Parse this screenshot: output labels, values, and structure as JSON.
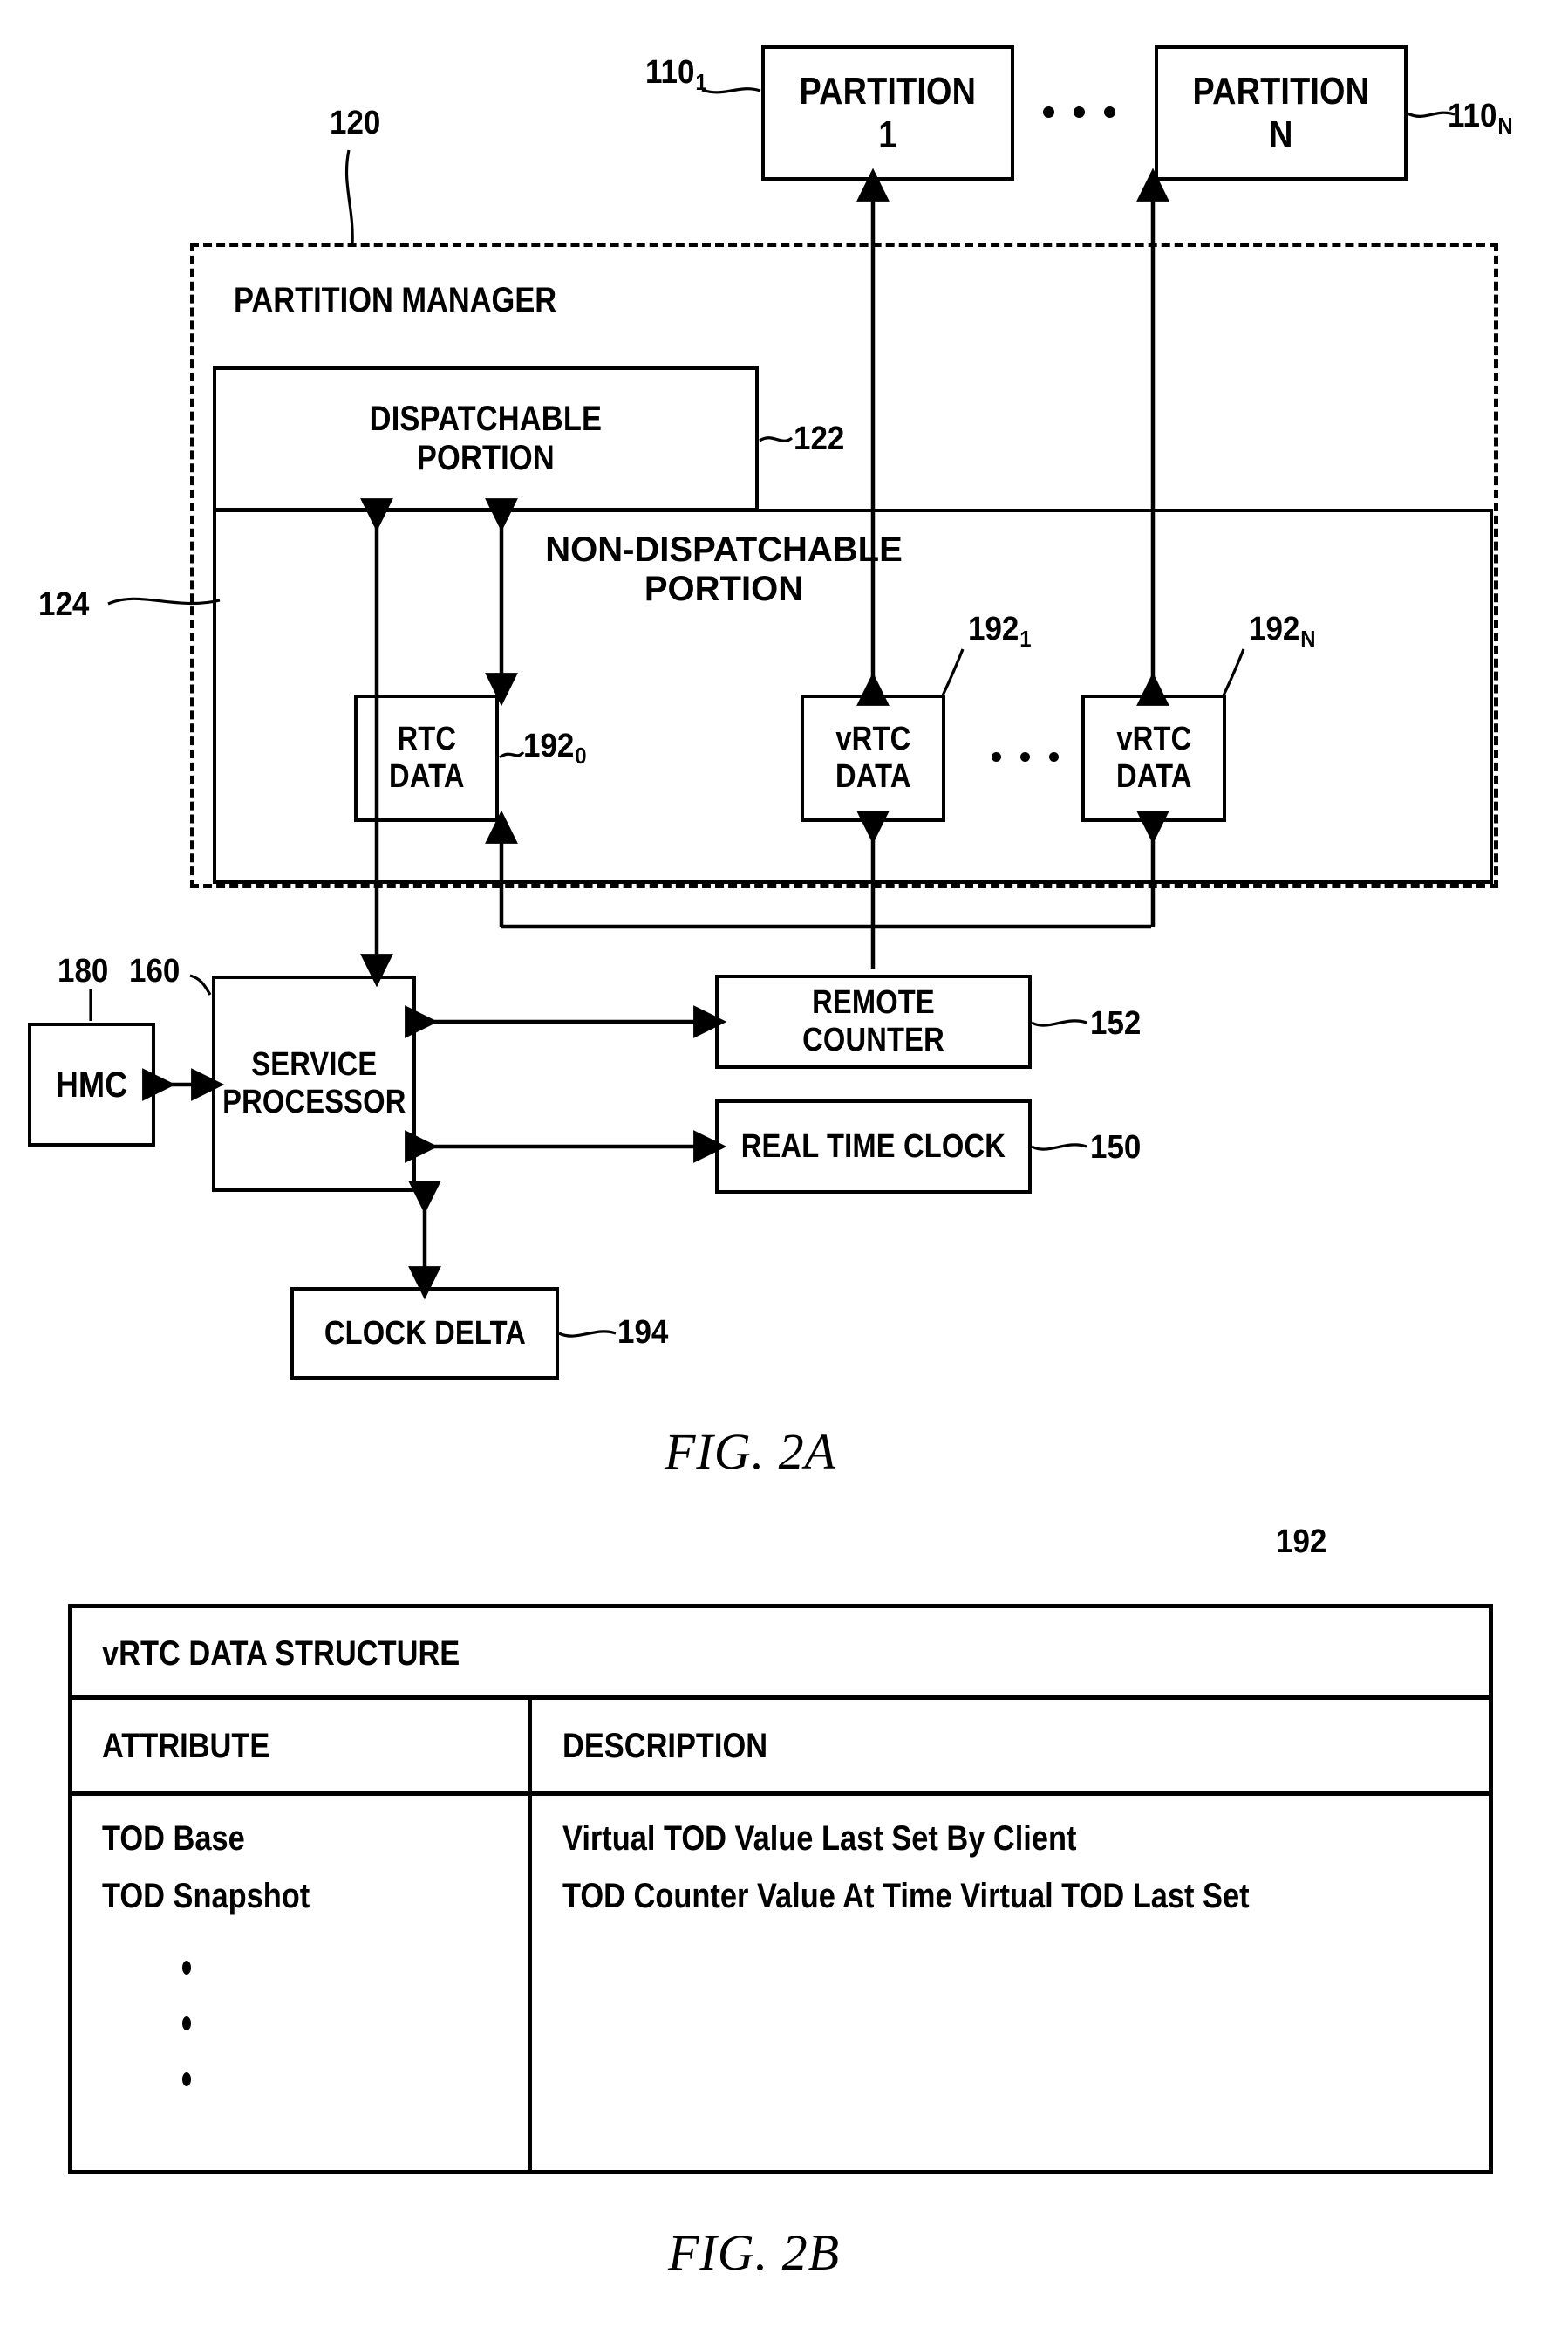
{
  "figures": {
    "fig2a_caption": "FIG. 2A",
    "fig2b_caption": "FIG. 2B"
  },
  "fig2a": {
    "partitions": [
      {
        "label": "PARTITION\n1",
        "ref": "110",
        "sub": "1"
      },
      {
        "label": "PARTITION\nN",
        "ref": "110",
        "sub": "N"
      }
    ],
    "partition_manager": {
      "title": "PARTITION MANAGER",
      "ref": "120",
      "dispatchable": {
        "label": "DISPATCHABLE\nPORTION",
        "ref": "122"
      },
      "non_dispatchable": {
        "label": "NON-DISPATCHABLE\nPORTION",
        "ref": "124"
      },
      "data_blocks": [
        {
          "label": "RTC\nDATA",
          "ref": "192",
          "sub": "0"
        },
        {
          "label": "vRTC\nDATA",
          "ref": "192",
          "sub": "1"
        },
        {
          "label": "vRTC\nDATA",
          "ref": "192",
          "sub": "N"
        }
      ]
    },
    "hmc": {
      "label": "HMC",
      "ref": "180"
    },
    "service_processor": {
      "label": "SERVICE\nPROCESSOR",
      "ref": "160"
    },
    "remote_counter": {
      "label": "REMOTE COUNTER",
      "ref": "152"
    },
    "real_time_clock": {
      "label": "REAL TIME CLOCK",
      "ref": "150"
    },
    "clock_delta": {
      "label": "CLOCK DELTA",
      "ref": "194"
    }
  },
  "fig2b": {
    "table_ref": "192",
    "title": "vRTC DATA STRUCTURE",
    "columns": [
      "ATTRIBUTE",
      "DESCRIPTION"
    ],
    "rows": [
      {
        "attribute": "TOD Base",
        "description": "Virtual TOD Value Last Set By Client"
      },
      {
        "attribute": "TOD Snapshot",
        "description": "TOD Counter Value At Time Virtual TOD Last Set"
      }
    ],
    "continuation": "vertical-ellipsis"
  }
}
